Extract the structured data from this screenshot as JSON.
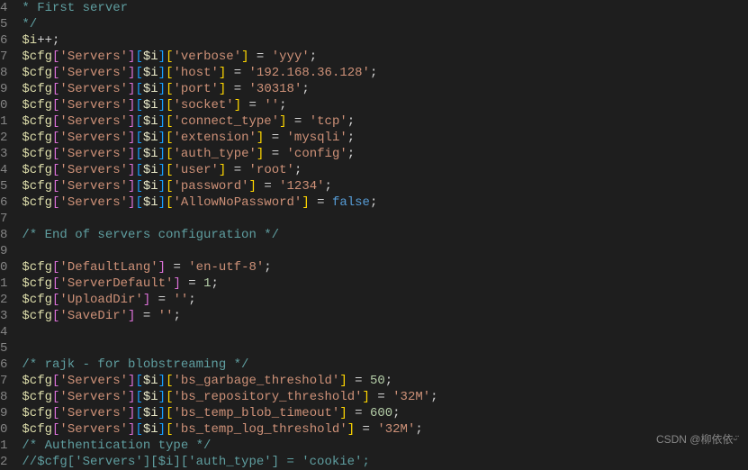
{
  "lines": [
    {
      "n": "4",
      "type": "comment",
      "text": " * First server"
    },
    {
      "n": "5",
      "type": "comment",
      "text": " */"
    },
    {
      "n": "6",
      "type": "inc",
      "var": "$i"
    },
    {
      "n": "7",
      "type": "assign3",
      "keys": [
        "Servers",
        "$i",
        "verbose"
      ],
      "val": "'yyy'",
      "valtype": "str"
    },
    {
      "n": "8",
      "type": "assign3",
      "keys": [
        "Servers",
        "$i",
        "host"
      ],
      "val": "'192.168.36.128'",
      "valtype": "str"
    },
    {
      "n": "9",
      "type": "assign3",
      "keys": [
        "Servers",
        "$i",
        "port"
      ],
      "val": "'30318'",
      "valtype": "str"
    },
    {
      "n": "0",
      "type": "assign3",
      "keys": [
        "Servers",
        "$i",
        "socket"
      ],
      "val": "''",
      "valtype": "str"
    },
    {
      "n": "1",
      "type": "assign3",
      "keys": [
        "Servers",
        "$i",
        "connect_type"
      ],
      "val": "'tcp'",
      "valtype": "str"
    },
    {
      "n": "2",
      "type": "assign3",
      "keys": [
        "Servers",
        "$i",
        "extension"
      ],
      "val": "'mysqli'",
      "valtype": "str"
    },
    {
      "n": "3",
      "type": "assign3",
      "keys": [
        "Servers",
        "$i",
        "auth_type"
      ],
      "val": "'config'",
      "valtype": "str"
    },
    {
      "n": "4",
      "type": "assign3",
      "keys": [
        "Servers",
        "$i",
        "user"
      ],
      "val": "'root'",
      "valtype": "str"
    },
    {
      "n": "5",
      "type": "assign3",
      "keys": [
        "Servers",
        "$i",
        "password"
      ],
      "val": "'1234'",
      "valtype": "str"
    },
    {
      "n": "6",
      "type": "assign3",
      "keys": [
        "Servers",
        "$i",
        "AllowNoPassword"
      ],
      "val": "false",
      "valtype": "kw"
    },
    {
      "n": "7",
      "type": "blank"
    },
    {
      "n": "8",
      "type": "comment",
      "text": " /* End of servers configuration */"
    },
    {
      "n": "9",
      "type": "blank"
    },
    {
      "n": "0",
      "type": "assign1",
      "keys": [
        "DefaultLang"
      ],
      "val": "'en-utf-8'",
      "valtype": "str"
    },
    {
      "n": "1",
      "type": "assign1",
      "keys": [
        "ServerDefault"
      ],
      "val": "1",
      "valtype": "num"
    },
    {
      "n": "2",
      "type": "assign1",
      "keys": [
        "UploadDir"
      ],
      "val": "''",
      "valtype": "str"
    },
    {
      "n": "3",
      "type": "assign1",
      "keys": [
        "SaveDir"
      ],
      "val": "''",
      "valtype": "str"
    },
    {
      "n": "4",
      "type": "blank"
    },
    {
      "n": "5",
      "type": "blank"
    },
    {
      "n": "6",
      "type": "comment",
      "text": " /* rajk - for blobstreaming */"
    },
    {
      "n": "7",
      "type": "assign3",
      "keys": [
        "Servers",
        "$i",
        "bs_garbage_threshold"
      ],
      "val": "50",
      "valtype": "num"
    },
    {
      "n": "8",
      "type": "assign3",
      "keys": [
        "Servers",
        "$i",
        "bs_repository_threshold"
      ],
      "val": "'32M'",
      "valtype": "str"
    },
    {
      "n": "9",
      "type": "assign3",
      "keys": [
        "Servers",
        "$i",
        "bs_temp_blob_timeout"
      ],
      "val": "600",
      "valtype": "num"
    },
    {
      "n": "0",
      "type": "assign3",
      "keys": [
        "Servers",
        "$i",
        "bs_temp_log_threshold"
      ],
      "val": "'32M'",
      "valtype": "str"
    },
    {
      "n": "1",
      "type": "comment",
      "text": " /* Authentication type */"
    },
    {
      "n": "2",
      "type": "commentcode",
      "text": " //$cfg['Servers'][$i]['auth_type'] = 'cookie';"
    }
  ],
  "watermark": "CSDN @柳依依ᵕ̈"
}
